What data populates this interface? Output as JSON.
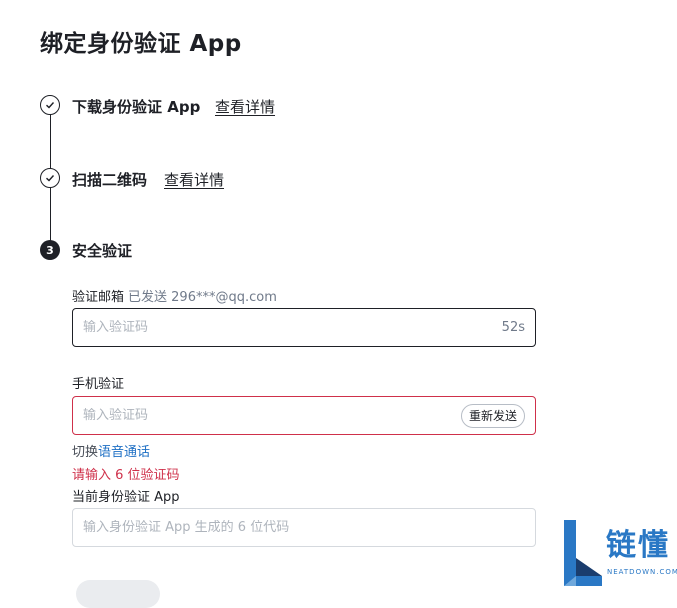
{
  "page": {
    "title": "绑定身份验证 App"
  },
  "steps": [
    {
      "label": "下载身份验证 App",
      "link": "查看详情",
      "status": "done"
    },
    {
      "label": "扫描二维码",
      "link": "查看详情",
      "status": "done"
    },
    {
      "label": "安全验证",
      "number": "3",
      "status": "current"
    }
  ],
  "email_verify": {
    "label": "验证邮箱",
    "sent_text": "已发送 296***@qq.com",
    "placeholder": "输入验证码",
    "countdown": "52s"
  },
  "phone_verify": {
    "label": "手机验证",
    "placeholder": "输入验证码",
    "resend_label": "重新发送",
    "switch_prefix": "切换",
    "switch_link": "语音通话",
    "error": "请输入 6 位验证码"
  },
  "authenticator": {
    "label": "当前身份验证 App",
    "placeholder": "输入身份验证 App 生成的 6 位代码"
  },
  "watermark": {
    "brand": "链懂",
    "domain": "NEATDOWN.COM"
  },
  "colors": {
    "text": "#1e2026",
    "error": "#cf304a",
    "link_blue": "#1e6fc4",
    "logo_blue": "#2a78c5"
  }
}
